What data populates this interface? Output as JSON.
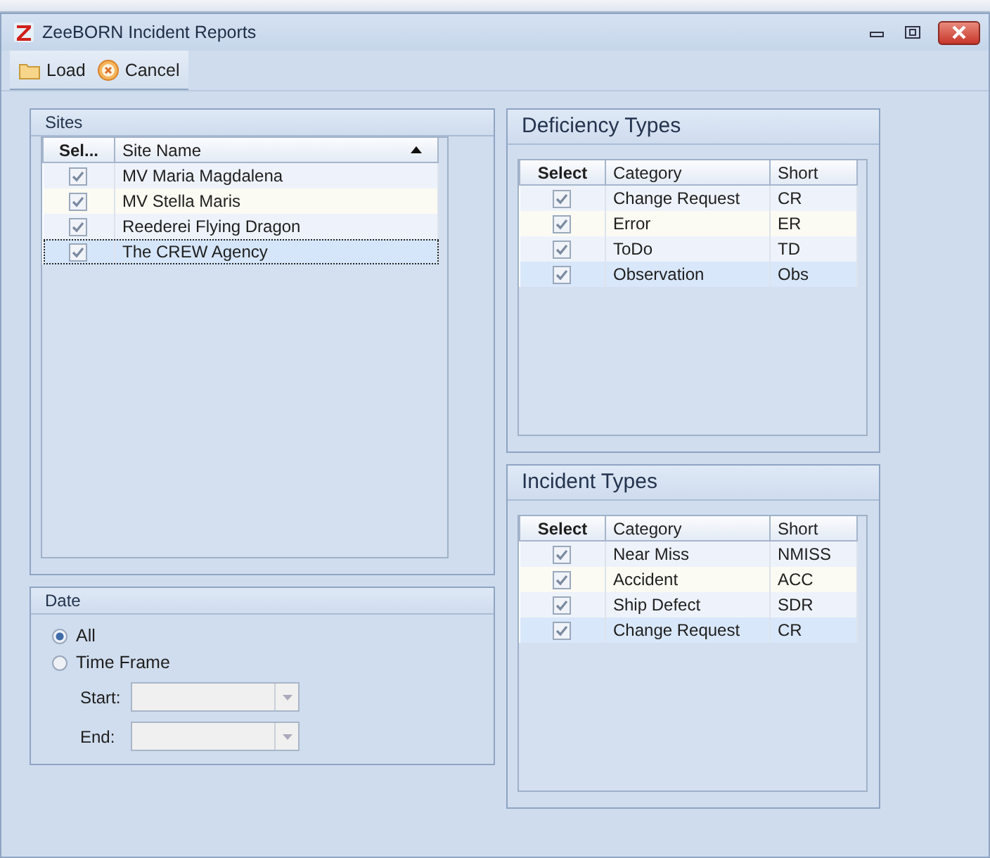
{
  "window": {
    "title": "ZeeBORN Incident Reports"
  },
  "toolbar": [
    {
      "label": "Load",
      "kind": "folder"
    },
    {
      "label": "Cancel",
      "kind": "cancel"
    }
  ],
  "sites": {
    "title": "Sites",
    "columns": [
      "Sel...",
      "Site Name"
    ],
    "rows": [
      {
        "name": "MV Maria Magdalena",
        "checked": true,
        "selected": false
      },
      {
        "name": "MV Stella Maris",
        "checked": true,
        "selected": false
      },
      {
        "name": "Reederei Flying Dragon",
        "checked": true,
        "selected": false
      },
      {
        "name": "The CREW Agency",
        "checked": true,
        "selected": true
      }
    ]
  },
  "date": {
    "title": "Date",
    "options": [
      {
        "label": "All",
        "selected": true
      },
      {
        "label": "Time Frame",
        "selected": false
      }
    ],
    "fields": [
      {
        "label": "Start:",
        "disabled": true
      },
      {
        "label": "End:",
        "disabled": true
      }
    ]
  },
  "deficiency_types": {
    "title": "Deficiency Types",
    "columns": [
      "Select",
      "Category",
      "Short"
    ],
    "rows": [
      {
        "category": "Change Request",
        "short": "CR",
        "checked": true,
        "selected": false
      },
      {
        "category": "Error",
        "short": "ER",
        "checked": true,
        "selected": false
      },
      {
        "category": "ToDo",
        "short": "TD",
        "checked": true,
        "selected": false
      },
      {
        "category": "Observation",
        "short": "Obs",
        "checked": true,
        "selected": true
      }
    ]
  },
  "incident_types": {
    "title": "Incident Types",
    "columns": [
      "Select",
      "Category",
      "Short"
    ],
    "rows": [
      {
        "category": "Near Miss",
        "short": "NMISS",
        "checked": true,
        "selected": false
      },
      {
        "category": "Accident",
        "short": "ACC",
        "checked": true,
        "selected": false
      },
      {
        "category": "Ship Defect",
        "short": "SDR",
        "checked": true,
        "selected": false
      },
      {
        "category": "Change Request",
        "short": "CR",
        "checked": true,
        "selected": true
      }
    ]
  }
}
